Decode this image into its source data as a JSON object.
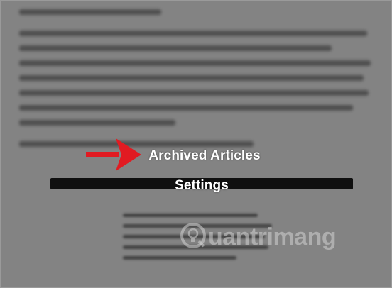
{
  "menu": {
    "items": [
      {
        "label": "Archived Articles"
      },
      {
        "label": "Settings"
      }
    ]
  },
  "annotation": {
    "arrow_color": "#e11b22"
  },
  "watermark": {
    "text": "uantrimang",
    "icon": "lightbulb-icon"
  },
  "colors": {
    "overlay": "#3a3a3a",
    "menu_text": "#ffffff"
  }
}
